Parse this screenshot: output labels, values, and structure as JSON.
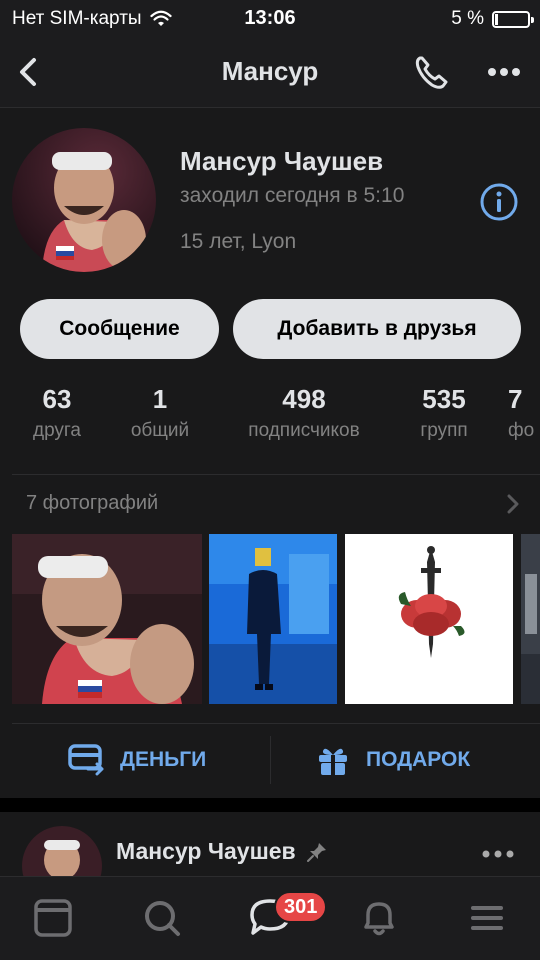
{
  "status_bar": {
    "carrier": "Нет SIM-карты",
    "time": "13:06",
    "battery_percent": "5 %",
    "battery_level": 0.05
  },
  "nav": {
    "title": "Мансур",
    "back_icon": "chevron-left-icon",
    "call_icon": "phone-icon",
    "more_icon": "more-horizontal-icon"
  },
  "profile": {
    "name": "Мансур Чаушев",
    "last_seen": "заходил сегодня в 5:10",
    "details": "15 лет, Lyon",
    "message_button": "Сообщение",
    "add_friend_button": "Добавить в друзья"
  },
  "counters": [
    {
      "value": "63",
      "label": "друга"
    },
    {
      "value": "1",
      "label": "общий"
    },
    {
      "value": "498",
      "label": "подписчиков"
    },
    {
      "value": "535",
      "label": "групп"
    },
    {
      "value": "7",
      "label": "фо"
    }
  ],
  "photos": {
    "header": "7 фотографий"
  },
  "actions": {
    "money_label": "ДЕНЬГИ",
    "gift_label": "ПОДАРОК"
  },
  "post": {
    "author": "Мансур Чаушев"
  },
  "tab_bar": {
    "messages_badge": "301"
  },
  "colors": {
    "accent": "#71aaeb",
    "badge": "#e64646",
    "background": "#19191a"
  }
}
